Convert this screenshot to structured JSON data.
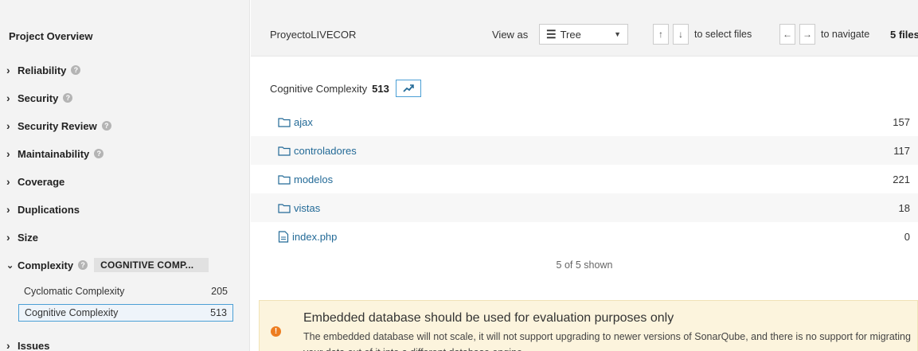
{
  "sidebar": {
    "title": "Project Overview",
    "items": [
      {
        "label": "Reliability",
        "help": true
      },
      {
        "label": "Security",
        "help": true
      },
      {
        "label": "Security Review",
        "help": true
      },
      {
        "label": "Maintainability",
        "help": true
      },
      {
        "label": "Coverage"
      },
      {
        "label": "Duplications"
      },
      {
        "label": "Size"
      },
      {
        "label": "Complexity",
        "help": true,
        "tag": "COGNITIVE COMP..."
      },
      {
        "label": "Issues"
      }
    ],
    "complexity_sub": [
      {
        "label": "Cyclomatic Complexity",
        "value": "205"
      },
      {
        "label": "Cognitive Complexity",
        "value": "513",
        "selected": true
      }
    ]
  },
  "topbar": {
    "project": "ProyectoLIVECOR",
    "view_as": "View as",
    "view_mode": "Tree",
    "select_hint": "to select files",
    "navigate_hint": "to navigate",
    "files_count": "5 files",
    "keys": {
      "up": "↑",
      "down": "↓",
      "left": "←",
      "right": "→"
    }
  },
  "metric": {
    "label": "Cognitive Complexity",
    "value": "513"
  },
  "files": [
    {
      "name": "ajax",
      "type": "folder",
      "value": "157"
    },
    {
      "name": "controladores",
      "type": "folder",
      "value": "117"
    },
    {
      "name": "modelos",
      "type": "folder",
      "value": "221"
    },
    {
      "name": "vistas",
      "type": "folder",
      "value": "18"
    },
    {
      "name": "index.php",
      "type": "file",
      "value": "0"
    }
  ],
  "shown": "5 of 5 shown",
  "warning": {
    "title": "Embedded database should be used for evaluation purposes only",
    "text": "The embedded database will not scale, it will not support upgrading to newer versions of SonarQube, and there is no support for migrating your data out of it into a different database engine."
  },
  "colors": {
    "link": "#236a97",
    "accent": "#4b9fd5",
    "warning_bg": "#fcf4dd",
    "warning_icon": "#ed7d20"
  }
}
